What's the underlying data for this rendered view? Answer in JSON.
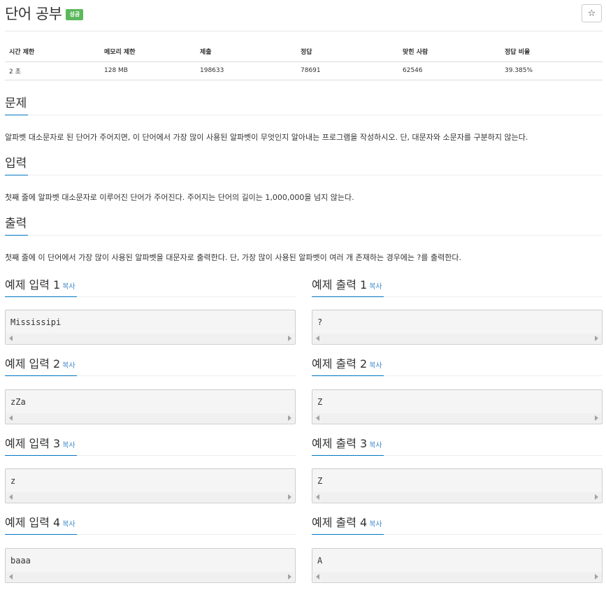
{
  "problem": {
    "title": "단어 공부",
    "badge": "성공",
    "star_icon": "star-icon"
  },
  "info_table": {
    "headers": [
      "시간 제한",
      "메모리 제한",
      "제출",
      "정답",
      "맞힌 사람",
      "정답 비율"
    ],
    "values": [
      "2 초",
      "128 MB",
      "198633",
      "78691",
      "62546",
      "39.385%"
    ]
  },
  "sections": {
    "problem_label": "문제",
    "problem_text": "알파벳 대소문자로 된 단어가 주어지면, 이 단어에서 가장 많이 사용된 알파벳이 무엇인지 알아내는 프로그램을 작성하시오. 단, 대문자와 소문자를 구분하지 않는다.",
    "input_label": "입력",
    "input_text": "첫째 줄에 알파벳 대소문자로 이루어진 단어가 주어진다. 주어지는 단어의 길이는 1,000,000을 넘지 않는다.",
    "output_label": "출력",
    "output_text": "첫째 줄에 이 단어에서 가장 많이 사용된 알파벳을 대문자로 출력한다. 단, 가장 많이 사용된 알파벳이 여러 개 존재하는 경우에는 ?를 출력한다."
  },
  "copy_label": "복사",
  "samples": [
    {
      "input_label": "예제 입력 1",
      "input": "Mississipi",
      "output_label": "예제 출력 1",
      "output": "?"
    },
    {
      "input_label": "예제 입력 2",
      "input": "zZa",
      "output_label": "예제 출력 2",
      "output": "Z"
    },
    {
      "input_label": "예제 입력 3",
      "input": "z",
      "output_label": "예제 출력 3",
      "output": "Z"
    },
    {
      "input_label": "예제 입력 4",
      "input": "baaa",
      "output_label": "예제 출력 4",
      "output": "A"
    }
  ],
  "colors": {
    "badge": "#5cb85c",
    "accent": "#0076c0",
    "link": "#428bca"
  }
}
